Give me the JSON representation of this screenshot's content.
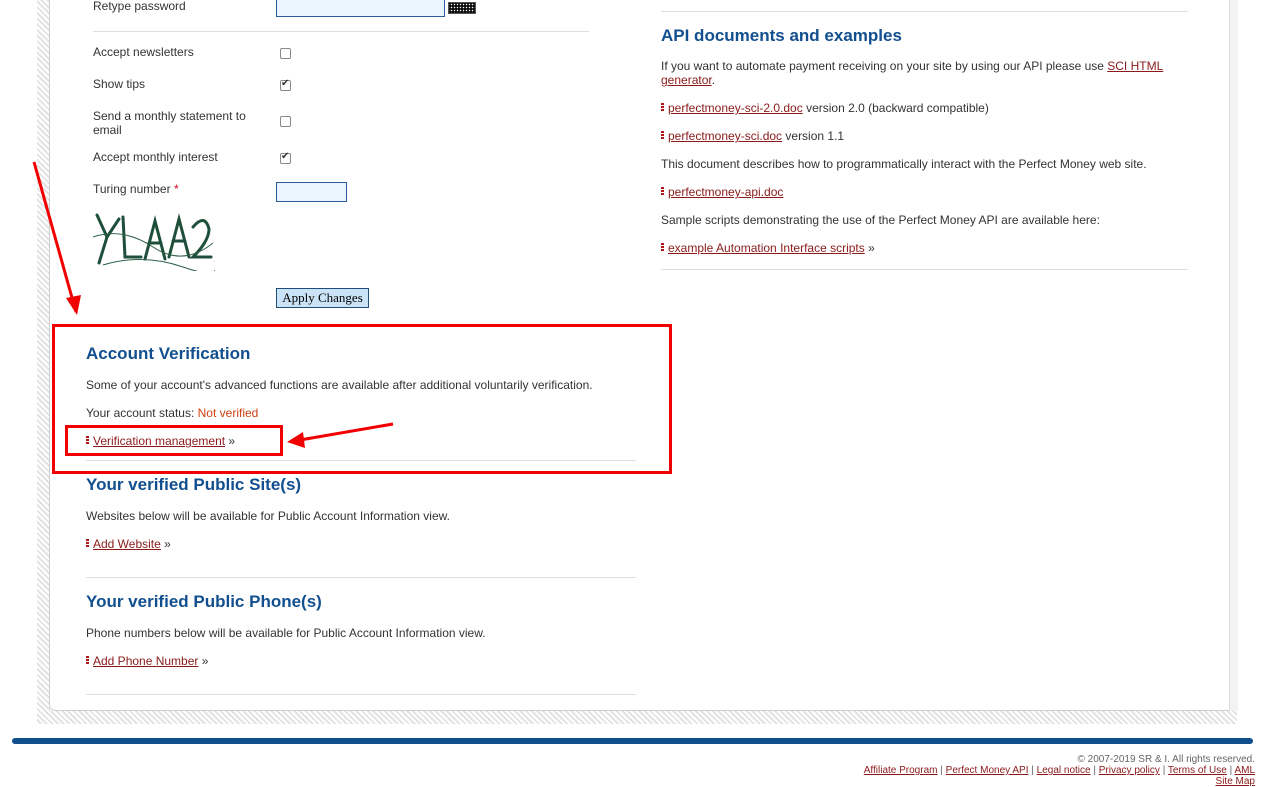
{
  "form": {
    "retype_password_label": "Retype password",
    "accept_newsletters_label": "Accept newsletters",
    "accept_newsletters_checked": false,
    "show_tips_label": "Show tips",
    "show_tips_checked": true,
    "monthly_statement_label": "Send a monthly statement to email",
    "monthly_statement_checked": false,
    "monthly_interest_label": "Accept monthly interest",
    "monthly_interest_checked": true,
    "turing_label": "Turing number",
    "required_mark": "*",
    "captcha_text": "YL4A2",
    "apply_button": "Apply Changes"
  },
  "verification": {
    "title": "Account Verification",
    "description": "Some of your account's advanced functions are available after additional voluntarily verification.",
    "status_label": "Your account status:",
    "status_value": "Not verified",
    "link": "Verification management",
    "raquo": "»"
  },
  "public_sites": {
    "title": "Your verified Public Site(s)",
    "description": "Websites below will be available for Public Account Information view.",
    "link": "Add Website",
    "raquo": "»"
  },
  "public_phones": {
    "title": "Your verified Public Phone(s)",
    "description": "Phone numbers below will be available for Public Account Information view.",
    "link": "Add Phone Number",
    "raquo": "»"
  },
  "api": {
    "title": "API documents and examples",
    "intro": "If you want to automate payment receiving on your site by using our API please use",
    "intro_link_1": "SCI HTML",
    "intro_link_2": "generator",
    "intro_end": ".",
    "doc1_link": "perfectmoney-sci-2.0.doc",
    "doc1_text": "version 2.0 (backward compatible)",
    "doc2_link": "perfectmoney-sci.doc",
    "doc2_text": "version 1.1",
    "api_desc": "This document describes how to programmatically interact with the Perfect Money web site.",
    "doc3_link": "perfectmoney-api.doc",
    "samples_desc": "Sample scripts demonstrating the use of the Perfect Money API are available here:",
    "samples_link": "example Automation Interface scripts",
    "raquo": "»"
  },
  "footer": {
    "copyright": "© 2007-2019 SR & I. All rights reserved.",
    "links": [
      "Affiliate Program",
      "Perfect Money API",
      "Legal notice",
      "Privacy policy",
      "Terms of Use",
      "AML"
    ],
    "separator": "|",
    "sitemap": "Site Map"
  },
  "colors": {
    "heading": "#124f8f",
    "link": "#8b1a1a",
    "status_not_verified": "#d04010",
    "annotation": "#f00000",
    "footer_bar": "#124f8f"
  }
}
